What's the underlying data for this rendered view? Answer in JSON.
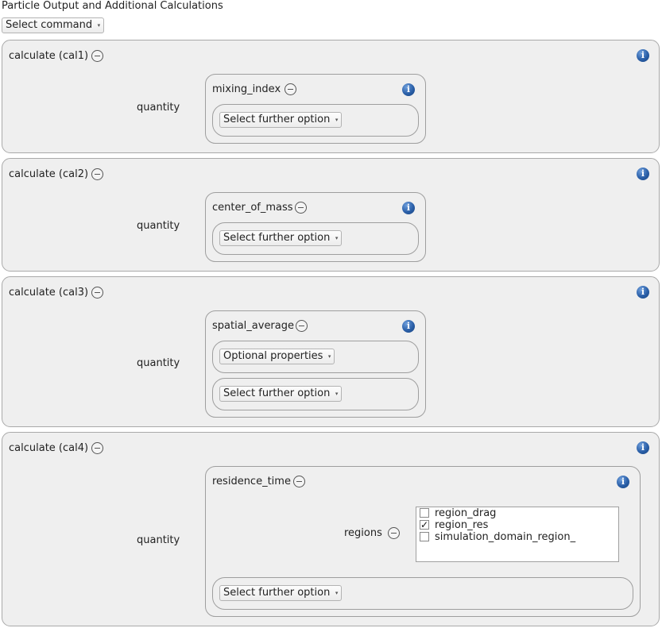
{
  "page": {
    "title": "Particle Output and Additional Calculations"
  },
  "command_dropdown": {
    "label": "Select command"
  },
  "calculations": [
    {
      "header": "calculate (cal1)",
      "quantity_label": "quantity",
      "quantity": {
        "name": "mixing_index",
        "further_option": "Select further option"
      }
    },
    {
      "header": "calculate (cal2)",
      "quantity_label": "quantity",
      "quantity": {
        "name": "center_of_mass",
        "further_option": "Select further option"
      }
    },
    {
      "header": "calculate (cal3)",
      "quantity_label": "quantity",
      "quantity": {
        "name": "spatial_average",
        "optional_properties": "Optional properties",
        "further_option": "Select further option"
      }
    },
    {
      "header": "calculate (cal4)",
      "quantity_label": "quantity",
      "quantity": {
        "name": "residence_time",
        "regions_label": "regions",
        "regions": [
          {
            "label": "region_drag",
            "checked": false
          },
          {
            "label": "region_res",
            "checked": true
          },
          {
            "label": "simulation_domain_region_",
            "checked": false
          }
        ],
        "further_option": "Select further option"
      }
    }
  ],
  "icons": {
    "info": "info-icon",
    "remove": "minus-circle-icon",
    "dropdown": "chevron-down-icon",
    "check": "checkmark-icon"
  },
  "symbols": {
    "info_glyph": "i",
    "caret": "▾",
    "check_glyph": "✓"
  },
  "colors": {
    "panel_bg": "#efefef",
    "border": "#a9a9a9",
    "info_blue": "#2a5fa8"
  }
}
